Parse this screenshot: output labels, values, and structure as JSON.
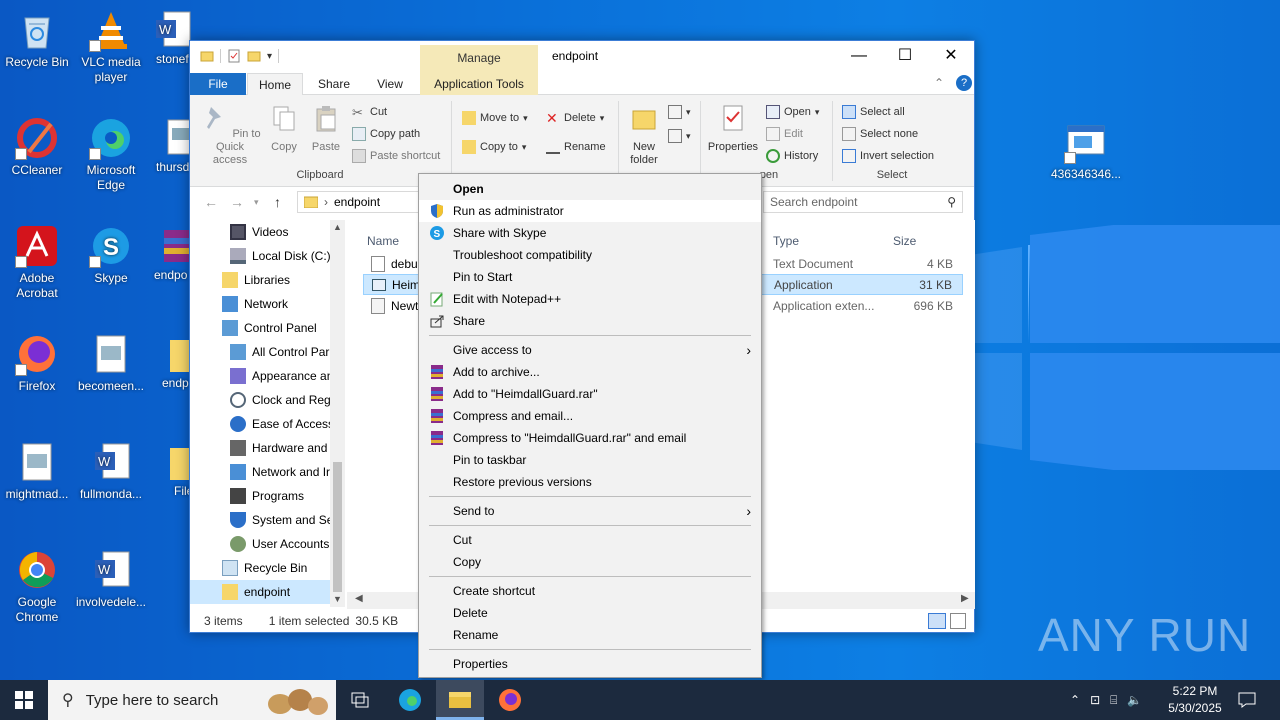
{
  "desktop": {
    "icons": [
      {
        "label": "Recycle Bin"
      },
      {
        "label": "VLC media player"
      },
      {
        "label": "stonef"
      },
      {
        "label": "CCleaner"
      },
      {
        "label": "Microsoft Edge"
      },
      {
        "label": "thursd"
      },
      {
        "label": "Adobe Acrobat"
      },
      {
        "label": "Skype"
      },
      {
        "label": "endpo"
      },
      {
        "label": "Firefox"
      },
      {
        "label": "becomeen..."
      },
      {
        "label": "endp"
      },
      {
        "label": "mightmad..."
      },
      {
        "label": "fullmonda..."
      },
      {
        "label": "File"
      },
      {
        "label": "Google Chrome"
      },
      {
        "label": "involvedele..."
      },
      {
        "label": "436346346..."
      }
    ]
  },
  "window": {
    "manage_tab": "Manage",
    "title": "endpoint",
    "tabs": [
      "File",
      "Home",
      "Share",
      "View",
      "Application Tools"
    ],
    "ribbon": {
      "pin_to_quick_access": "Pin to Quick access",
      "copy": "Copy",
      "paste": "Paste",
      "cut": "Cut",
      "copy_path": "Copy path",
      "paste_shortcut": "Paste shortcut",
      "clipboard_group": "Clipboard",
      "move_to": "Move to",
      "copy_to": "Copy to",
      "delete": "Delete",
      "rename": "Rename",
      "new_folder": "New folder",
      "properties": "Properties",
      "open": "Open",
      "edit": "Edit",
      "history": "History",
      "open_group": "pen",
      "select_all": "Select all",
      "select_none": "Select none",
      "invert_selection": "Invert selection",
      "select_group": "Select"
    },
    "address": {
      "path": "endpoint",
      "search_placeholder": "Search endpoint"
    },
    "nav": [
      {
        "label": "Videos"
      },
      {
        "label": "Local Disk (C:)"
      },
      {
        "label": "Libraries"
      },
      {
        "label": "Network"
      },
      {
        "label": "Control Panel"
      },
      {
        "label": "All Control Par"
      },
      {
        "label": "Appearance an"
      },
      {
        "label": "Clock and Regi"
      },
      {
        "label": "Ease of Access"
      },
      {
        "label": "Hardware and"
      },
      {
        "label": "Network and Ir"
      },
      {
        "label": "Programs"
      },
      {
        "label": "System and Sec"
      },
      {
        "label": "User Accounts"
      },
      {
        "label": "Recycle Bin"
      },
      {
        "label": "endpoint"
      }
    ],
    "columns": {
      "name": "Name",
      "type": "Type",
      "size": "Size"
    },
    "files": [
      {
        "name": "debug",
        "type": "Text Document",
        "size": "4 KB"
      },
      {
        "name": "Heim",
        "type": "Application",
        "size": "31 KB"
      },
      {
        "name": "Newto",
        "type": "Application exten...",
        "size": "696 KB"
      }
    ],
    "status": {
      "items": "3 items",
      "selected": "1 item selected",
      "size": "30.5 KB"
    }
  },
  "context_menu": {
    "items": [
      "Open",
      "Run as administrator",
      "Share with Skype",
      "Troubleshoot compatibility",
      "Pin to Start",
      "Edit with Notepad++",
      "Share",
      "Give access to",
      "Add to archive...",
      "Add to \"HeimdallGuard.rar\"",
      "Compress and email...",
      "Compress to \"HeimdallGuard.rar\" and email",
      "Pin to taskbar",
      "Restore previous versions",
      "Send to",
      "Cut",
      "Copy",
      "Create shortcut",
      "Delete",
      "Rename",
      "Properties"
    ]
  },
  "taskbar": {
    "search_placeholder": "Type here to search",
    "time": "5:22 PM",
    "date": "5/30/2025"
  },
  "watermark": "ANY RUN"
}
